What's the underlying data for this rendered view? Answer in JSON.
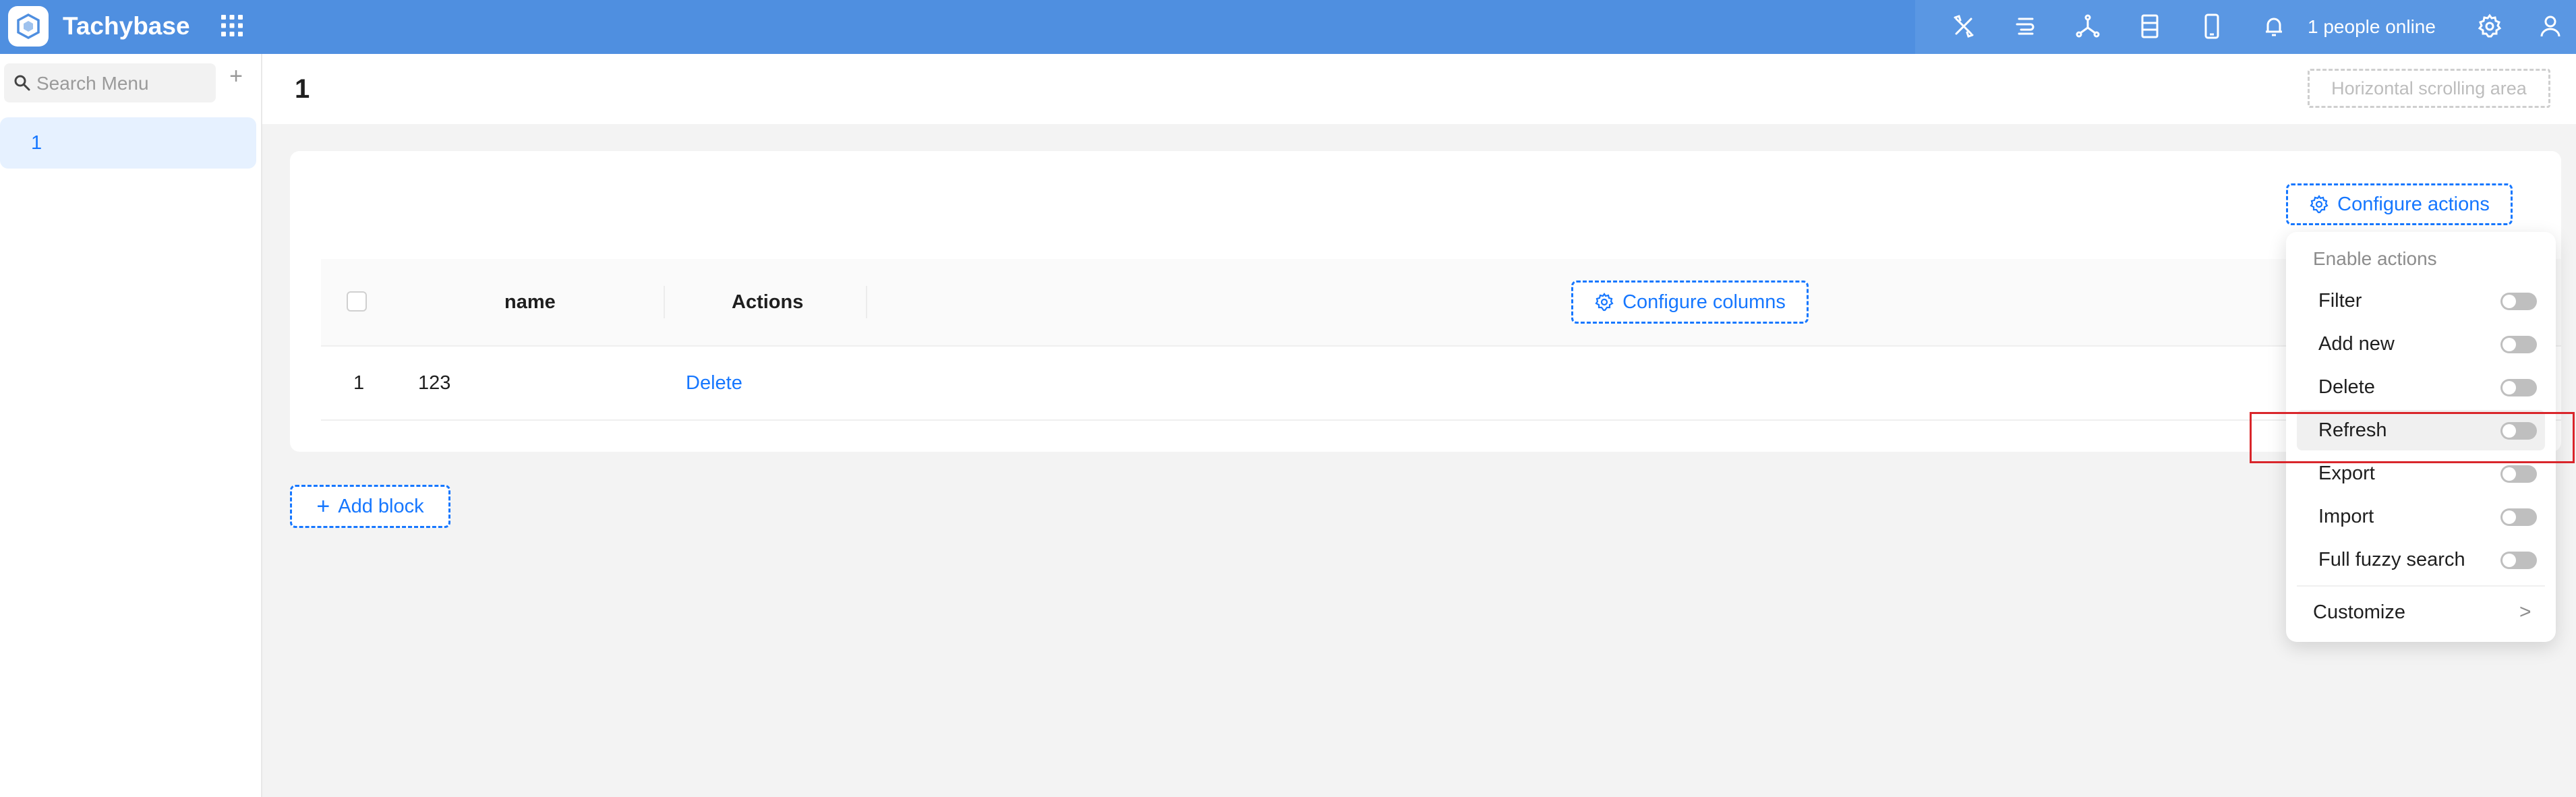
{
  "app": {
    "brand": "Tachybase"
  },
  "topbar": {
    "icons": [
      "tools-icon",
      "server-icon",
      "workflow-icon",
      "database-icon",
      "mobile-icon",
      "bell-icon"
    ],
    "online_text": "1 people online",
    "settings_icon": "gear-icon",
    "user_icon": "user-icon"
  },
  "sidebar": {
    "search_placeholder": "Search Menu",
    "add_symbol": "+",
    "items": [
      {
        "label": "1",
        "active": true
      }
    ]
  },
  "page": {
    "title": "1",
    "horizontal_scroll_label": "Horizontal scrolling area"
  },
  "table_block": {
    "configure_actions_label": "Configure actions",
    "configure_columns_label": "Configure columns",
    "columns": [
      "name",
      "Actions"
    ],
    "rows": [
      {
        "index": "1",
        "name": "123",
        "action": "Delete"
      }
    ]
  },
  "add_block_label": "Add block",
  "actions_menu": {
    "section_title": "Enable actions",
    "items": [
      {
        "label": "Filter",
        "enabled": false
      },
      {
        "label": "Add new",
        "enabled": false
      },
      {
        "label": "Delete",
        "enabled": false
      },
      {
        "label": "Refresh",
        "enabled": false,
        "highlighted": true
      },
      {
        "label": "Export",
        "enabled": false
      },
      {
        "label": "Import",
        "enabled": false
      },
      {
        "label": "Full fuzzy search",
        "enabled": false
      }
    ],
    "customize_label": "Customize",
    "customize_chevron": ">"
  },
  "colors": {
    "topbar": "#4f8fe0",
    "primary": "#1677ff",
    "highlight_border": "#d9262b"
  }
}
